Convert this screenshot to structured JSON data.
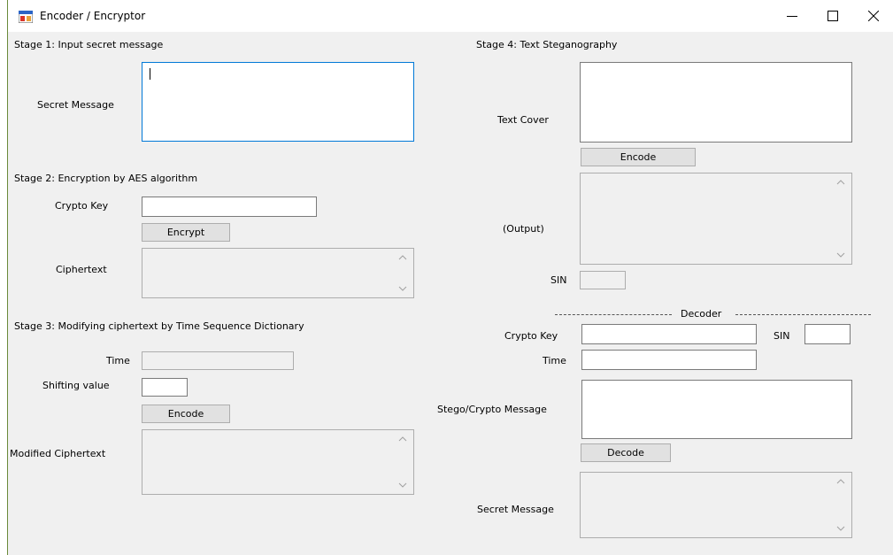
{
  "window": {
    "title": "Encoder / Encryptor"
  },
  "stage1": {
    "heading": "Stage 1: Input secret message",
    "secret_label": "Secret Message",
    "secret_value": ""
  },
  "stage2": {
    "heading": "Stage 2:  Encryption by AES algorithm",
    "key_label": "Crypto Key",
    "key_value": "",
    "encrypt_button": "Encrypt",
    "ciphertext_label": "Ciphertext",
    "ciphertext_value": ""
  },
  "stage3": {
    "heading": "Stage 3:  Modifying ciphertext by Time Sequence Dictionary",
    "time_label": "Time",
    "time_value": "",
    "shift_label": "Shifting value",
    "shift_value": "",
    "encode_button": "Encode",
    "modified_label": "Modified Ciphertext",
    "modified_value": ""
  },
  "stage4": {
    "heading": "Stage 4: Text Steganography",
    "cover_label": "Text Cover",
    "cover_value": "",
    "encode_button": "Encode",
    "output_label": "(Output)",
    "output_value": "",
    "sin_label": "SIN",
    "sin_value": ""
  },
  "decoder": {
    "heading": "Decoder",
    "key_label": "Crypto Key",
    "key_value": "",
    "sin_label": "SIN",
    "sin_value": "",
    "time_label": "Time",
    "time_value": "",
    "stego_label": "Stego/Crypto Message",
    "stego_value": "",
    "decode_button": "Decode",
    "secret_label": "Secret Message",
    "secret_value": ""
  }
}
